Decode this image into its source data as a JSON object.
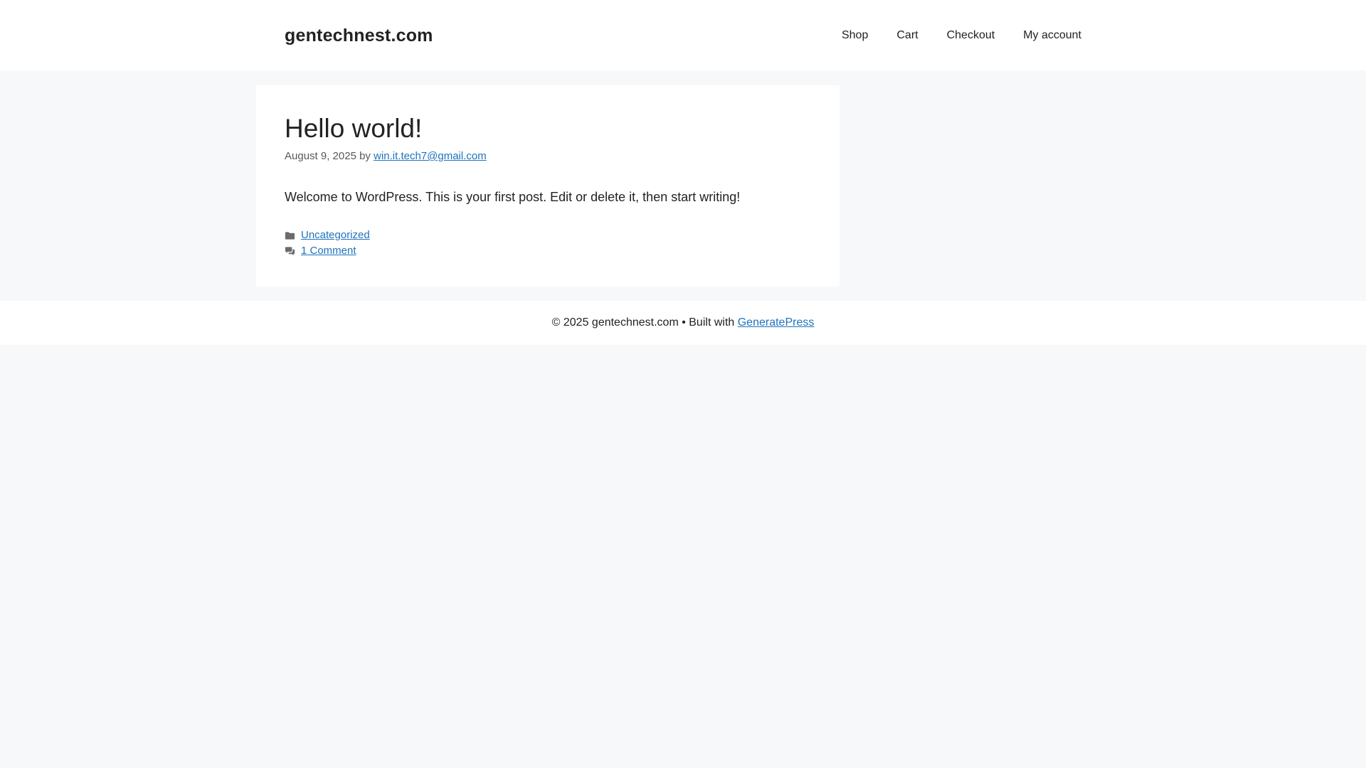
{
  "header": {
    "site_title": "gentechnest.com",
    "nav": [
      {
        "label": "Shop"
      },
      {
        "label": "Cart"
      },
      {
        "label": "Checkout"
      },
      {
        "label": "My account"
      }
    ]
  },
  "post": {
    "title": "Hello world!",
    "date": "August 9, 2025",
    "by_label": "by",
    "author": "win.it.tech7@gmail.com",
    "excerpt": "Welcome to WordPress. This is your first post. Edit or delete it, then start writing!",
    "category": "Uncategorized",
    "comments": "1 Comment",
    "category_icon": "folder-icon",
    "comments_icon": "comments-icon"
  },
  "footer": {
    "copyright": "© 2025 gentechnest.com • Built with",
    "credit_link": "GeneratePress"
  },
  "colors": {
    "background": "#f7f8f9",
    "surface": "#ffffff",
    "text": "#222222",
    "meta_text": "#595959",
    "link": "#1e73be",
    "icon": "#6b6b6b"
  }
}
